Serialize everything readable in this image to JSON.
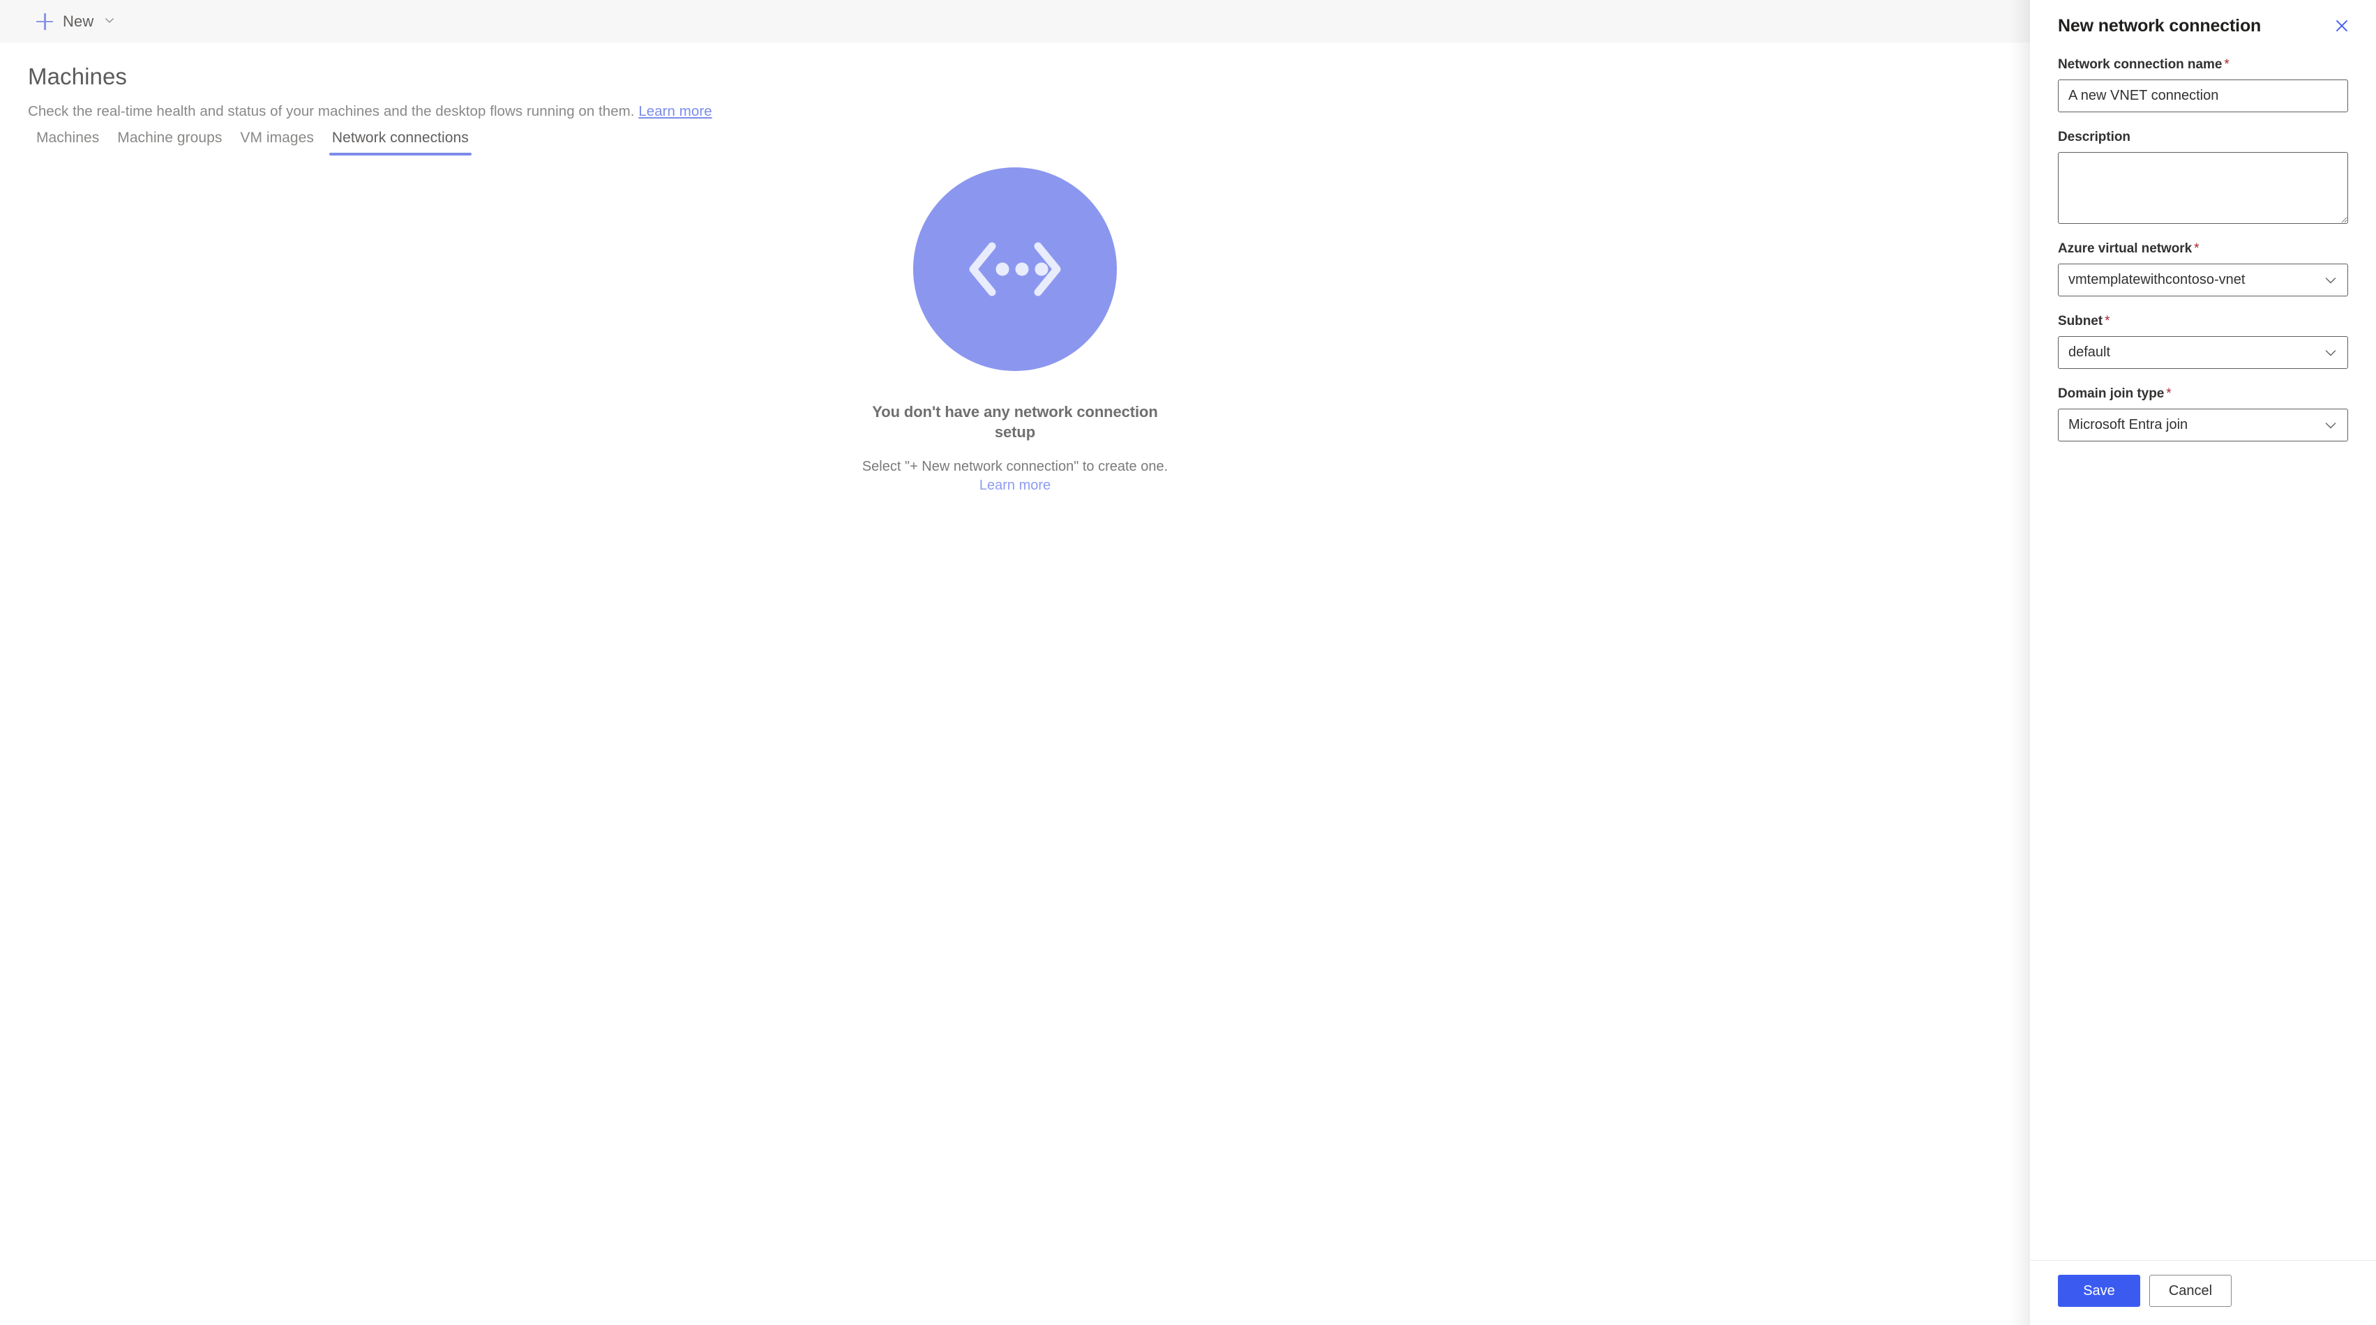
{
  "commandbar": {
    "new_button_label": "New",
    "plus_icon": "plus-icon",
    "chevron_icon": "chevron-down-icon"
  },
  "page": {
    "title": "Machines",
    "subtitle": "Check the real-time health and status of your machines and the desktop flows running on them.",
    "subtitle_link": "Learn more"
  },
  "tabs": [
    {
      "label": "Machines",
      "active": false
    },
    {
      "label": "Machine groups",
      "active": false
    },
    {
      "label": "VM images",
      "active": false
    },
    {
      "label": "Network connections",
      "active": true
    }
  ],
  "empty_state": {
    "illustration_icon": "network-connection-illustration",
    "title": "You don't have any network connection setup",
    "description_before": "Select \"+ New network connection\" to create one. ",
    "description_link": "Learn more"
  },
  "panel": {
    "title": "New network connection",
    "close_icon": "close-icon",
    "fields": {
      "name": {
        "label": "Network connection name",
        "required": true,
        "value": "A new VNET connection",
        "placeholder": ""
      },
      "description": {
        "label": "Description",
        "required": false,
        "value": "",
        "placeholder": ""
      },
      "vnet": {
        "label": "Azure virtual network",
        "required": true,
        "value": "vmtemplatewithcontoso-vnet",
        "chevron_icon": "chevron-down-icon"
      },
      "subnet": {
        "label": "Subnet",
        "required": true,
        "value": "default",
        "chevron_icon": "chevron-down-icon"
      },
      "domain_join_type": {
        "label": "Domain join type",
        "required": true,
        "value": "Microsoft Entra join",
        "chevron_icon": "chevron-down-icon"
      }
    },
    "footer": {
      "save_label": "Save",
      "cancel_label": "Cancel"
    }
  },
  "colors": {
    "accent_primary": "#3b5bf0",
    "accent_link": "#7b8ce8",
    "illustration_bg": "#8b97ef",
    "tab_underline": "#7d8ce9",
    "required_asterisk": "#a4262c",
    "commandbar_bg": "#f7f7f7"
  },
  "required_marker": "*"
}
